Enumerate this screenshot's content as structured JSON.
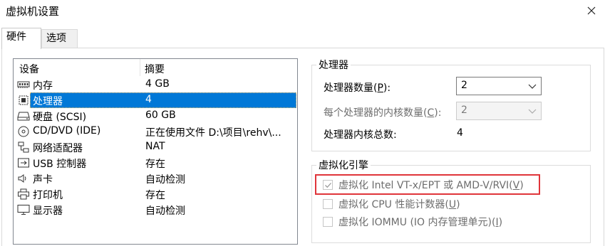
{
  "window": {
    "title": "虚拟机设置"
  },
  "tabs": [
    {
      "label": "硬件",
      "active": true
    },
    {
      "label": "选项",
      "active": false
    }
  ],
  "device_table": {
    "columns": [
      "设备",
      "摘要"
    ],
    "rows": [
      {
        "name": "内存",
        "summary": "4 GB",
        "icon": "memory-icon"
      },
      {
        "name": "处理器",
        "summary": "4",
        "icon": "processor-icon",
        "selected": true
      },
      {
        "name": "硬盘 (SCSI)",
        "summary": "60 GB",
        "icon": "hard-disk-icon"
      },
      {
        "name": "CD/DVD (IDE)",
        "summary": "正在使用文件 D:\\项目\\rehv\\...",
        "icon": "cd-dvd-icon"
      },
      {
        "name": "网络适配器",
        "summary": "NAT",
        "icon": "network-adapter-icon"
      },
      {
        "name": "USB 控制器",
        "summary": "存在",
        "icon": "usb-icon"
      },
      {
        "name": "声卡",
        "summary": "自动检测",
        "icon": "sound-card-icon"
      },
      {
        "name": "打印机",
        "summary": "存在",
        "icon": "printer-icon"
      },
      {
        "name": "显示器",
        "summary": "自动检测",
        "icon": "display-icon"
      }
    ]
  },
  "processor_group": {
    "title": "处理器",
    "cpu_count": {
      "label": "处理器数量(",
      "key": "P",
      "suffix": "):",
      "value": "2"
    },
    "cores_per_cpu": {
      "label": "每个处理器的内核数量(",
      "key": "C",
      "suffix": "):",
      "value": "2",
      "disabled": true
    },
    "total_cores": {
      "label": "处理器内核总数:",
      "value": "4"
    }
  },
  "virtualization_group": {
    "title": "虚拟化引擎",
    "options": [
      {
        "label": "虚拟化 Intel VT-x/EPT 或 AMD-V/RVI(",
        "key": "V",
        "suffix": ")",
        "checked": true,
        "disabled": true
      },
      {
        "label": "虚拟化 CPU 性能计数器(",
        "key": "U",
        "suffix": ")",
        "checked": false,
        "disabled": true
      },
      {
        "label": "虚拟化 IOMMU (IO 内存管理单元)(",
        "key": "I",
        "suffix": ")",
        "checked": false,
        "disabled": true
      }
    ]
  },
  "colors": {
    "selection": "#0078d7",
    "highlight_border": "#e0353a",
    "disabled_text": "#6d6d6d"
  }
}
